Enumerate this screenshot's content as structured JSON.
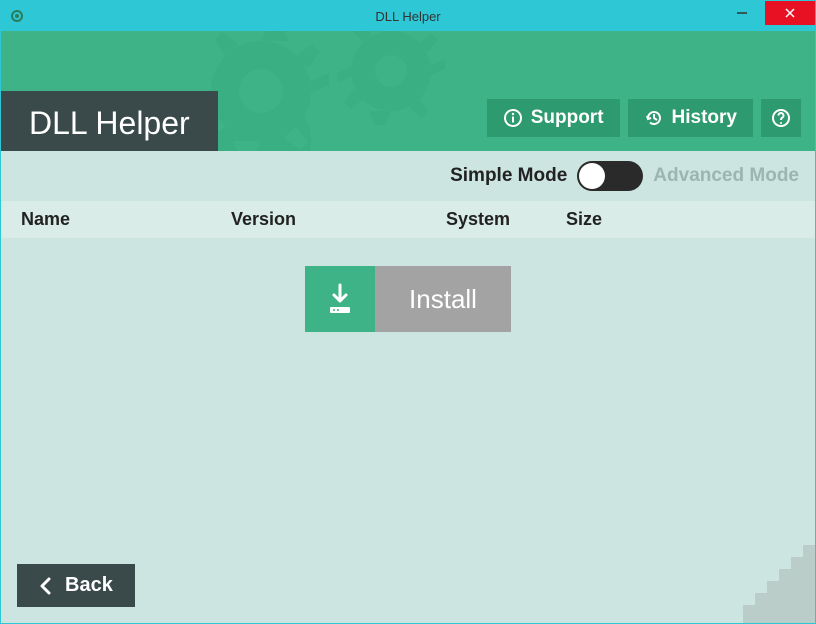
{
  "window": {
    "title": "DLL Helper"
  },
  "app": {
    "title": "DLL Helper"
  },
  "header": {
    "support_label": "Support",
    "history_label": "History"
  },
  "mode": {
    "simple_label": "Simple Mode",
    "advanced_label": "Advanced Mode",
    "state": "simple"
  },
  "table": {
    "columns": {
      "name": "Name",
      "version": "Version",
      "system": "System",
      "size": "Size"
    },
    "rows": []
  },
  "actions": {
    "install_label": "Install",
    "back_label": "Back"
  },
  "colors": {
    "titlebar": "#2ec7d6",
    "header_bg": "#3db387",
    "dark_panel": "#3a4a4a",
    "content_bg": "#cce5e0",
    "close_btn": "#e81123"
  }
}
